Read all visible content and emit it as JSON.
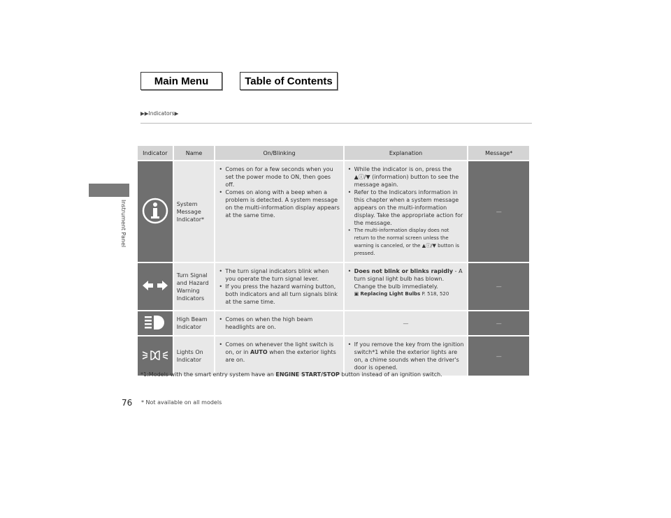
{
  "nav": {
    "main_menu": "Main Menu",
    "toc": "Table of Contents"
  },
  "breadcrumb": "▶▶Indicators▶",
  "side_label": "Instrument Panel",
  "page_number": "76",
  "footnote_avail": "* Not available on all models",
  "headers": {
    "indicator": "Indicator",
    "name": "Name",
    "on": "On/Blinking",
    "explanation": "Explanation",
    "message": "Message*"
  },
  "rows": [
    {
      "icon": "info-icon",
      "name": "System Message Indicator*",
      "on": [
        "Comes on for a few seconds when you set the power mode to ON, then goes off.",
        "Comes on along with a beep when a problem is detected. A system message on the multi-information display appears at the same time."
      ],
      "explanation": [
        "While the indicator is on, press the ▲ⓘ/▼ (information) button to see the message again.",
        "Refer to the Indicators information in this chapter when a system message appears on the multi-information display. Take the appropriate action for the message.",
        "The multi-information display does not return to the normal screen unless the warning is canceled, or the ▲ⓘ/▼ button is pressed."
      ],
      "message": "—"
    },
    {
      "icon": "turn-signal-icon",
      "name": "Turn Signal and Hazard Warning Indicators",
      "on": [
        "The turn signal indicators blink when you operate the turn signal lever.",
        "If you press the hazard warning button, both indicators and all turn signals blink at the same time."
      ],
      "explanation_bold": "Does not blink or blinks rapidly",
      "explanation_rest": " - A turn signal light bulb has blown. Change the bulb immediately.",
      "ref_label": "Replacing Light Bulbs",
      "ref_pages": "P. 518, 520",
      "message": "—"
    },
    {
      "icon": "high-beam-icon",
      "name": "High Beam Indicator",
      "on": [
        "Comes on when the high beam headlights are on."
      ],
      "explanation": "—",
      "message": "—"
    },
    {
      "icon": "lights-on-icon",
      "name": "Lights On Indicator",
      "on_a": "Comes on whenever the light switch is on, or in ",
      "on_bold": "AUTO",
      "on_b": " when the exterior lights are on.",
      "explanation": [
        "If you remove the key from the ignition switch*1 while the exterior lights are on, a chime sounds when the driver's door is opened."
      ],
      "message": "—"
    }
  ],
  "footnote": {
    "a": "*1:Models with the smart entry system have an ",
    "bold": "ENGINE START/STOP",
    "b": " button instead of an ignition switch."
  }
}
